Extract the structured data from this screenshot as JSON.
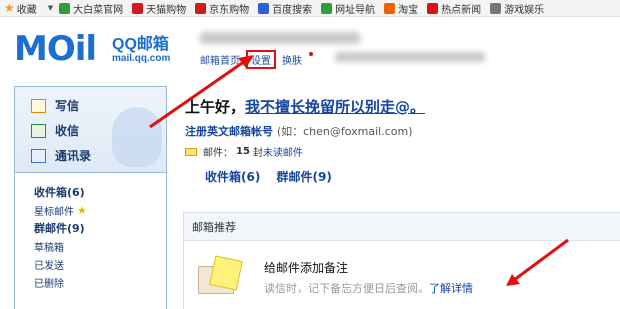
{
  "bookmarks": [
    {
      "label": "收藏",
      "icon": "star-icon",
      "color": "#f0a000"
    },
    {
      "label": "大白菜官网",
      "icon": "site-icon",
      "color": "#2e9e3a"
    },
    {
      "label": "天猫购物",
      "icon": "tmall-icon",
      "color": "#d01b1b"
    },
    {
      "label": "京东购物",
      "icon": "jd-icon",
      "color": "#d01b1b"
    },
    {
      "label": "百度搜索",
      "icon": "baidu-icon",
      "color": "#2b5fd8"
    },
    {
      "label": "网址导航",
      "icon": "nav-icon",
      "color": "#2e9e3a"
    },
    {
      "label": "淘宝",
      "icon": "taobao-icon",
      "color": "#f06000"
    },
    {
      "label": "热点新闻",
      "icon": "news-icon",
      "color": "#e01010"
    },
    {
      "label": "游戏娱乐",
      "icon": "game-icon",
      "color": "#777777"
    }
  ],
  "logo": {
    "main": "MOil",
    "qq": "QQ邮箱",
    "url": "mail.qq.com"
  },
  "topnav": {
    "home": "邮箱首页",
    "settings": "设置",
    "skin": "换肤"
  },
  "left": {
    "write": "写信",
    "receive": "收信",
    "contacts": "通讯录",
    "folders": {
      "inbox": "收件箱(6)",
      "starred": "星标邮件",
      "group": "群邮件(9)",
      "drafts": "草稿箱",
      "sent": "已发送",
      "deleted": "已删除"
    }
  },
  "main": {
    "greeting_prefix": "上午好，",
    "greeting_link": "我不擅长挽留所以别走@。",
    "account_label": "注册英文邮箱帐号",
    "account_hint": "(如：chen@foxmail.com)",
    "mail_prefix": "邮件：",
    "mail_count": "15",
    "mail_unit": "封",
    "mail_link": "未读邮件",
    "quick_inbox": "收件箱(6)",
    "quick_group": "群邮件(9)"
  },
  "recommend": {
    "header": "邮箱推荐",
    "title": "给邮件添加备注",
    "desc": "读信时，记下备忘方便日后查阅。",
    "more": "了解详情"
  },
  "colors": {
    "accent": "#1645a0",
    "annotation": "#e01010"
  }
}
